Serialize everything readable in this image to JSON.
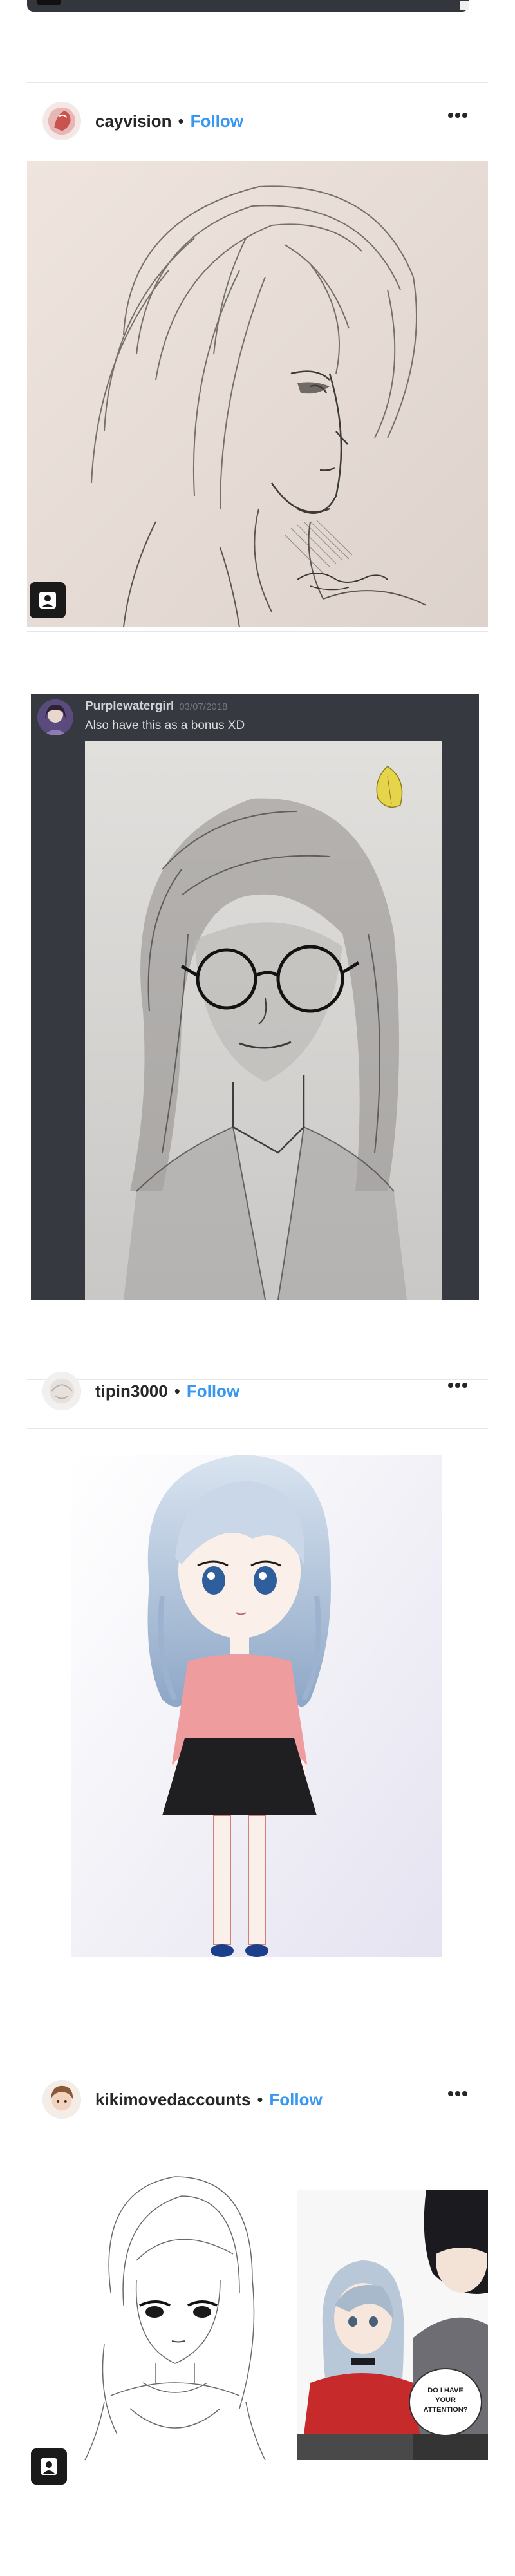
{
  "posts": [
    {
      "username": "cayvision",
      "separator": "•",
      "follow_label": "Follow"
    },
    {
      "username": "tipin3000",
      "separator": "•",
      "follow_label": "Follow"
    },
    {
      "username": "kikimovedaccounts",
      "separator": "•",
      "follow_label": "Follow"
    }
  ],
  "chat": {
    "author": "Purplewatergirl",
    "date": "03/07/2018",
    "message": "Also have this as a bonus XD"
  },
  "comic": {
    "speech_bubble_lines": [
      "DO I HAVE",
      "YOUR",
      "ATTENTION?"
    ]
  },
  "colors": {
    "follow": "#3897f0",
    "chat_background": "#36393f",
    "text": "#262626"
  },
  "icons": {
    "more": "more-options-icon",
    "tag": "user-tag-icon"
  }
}
